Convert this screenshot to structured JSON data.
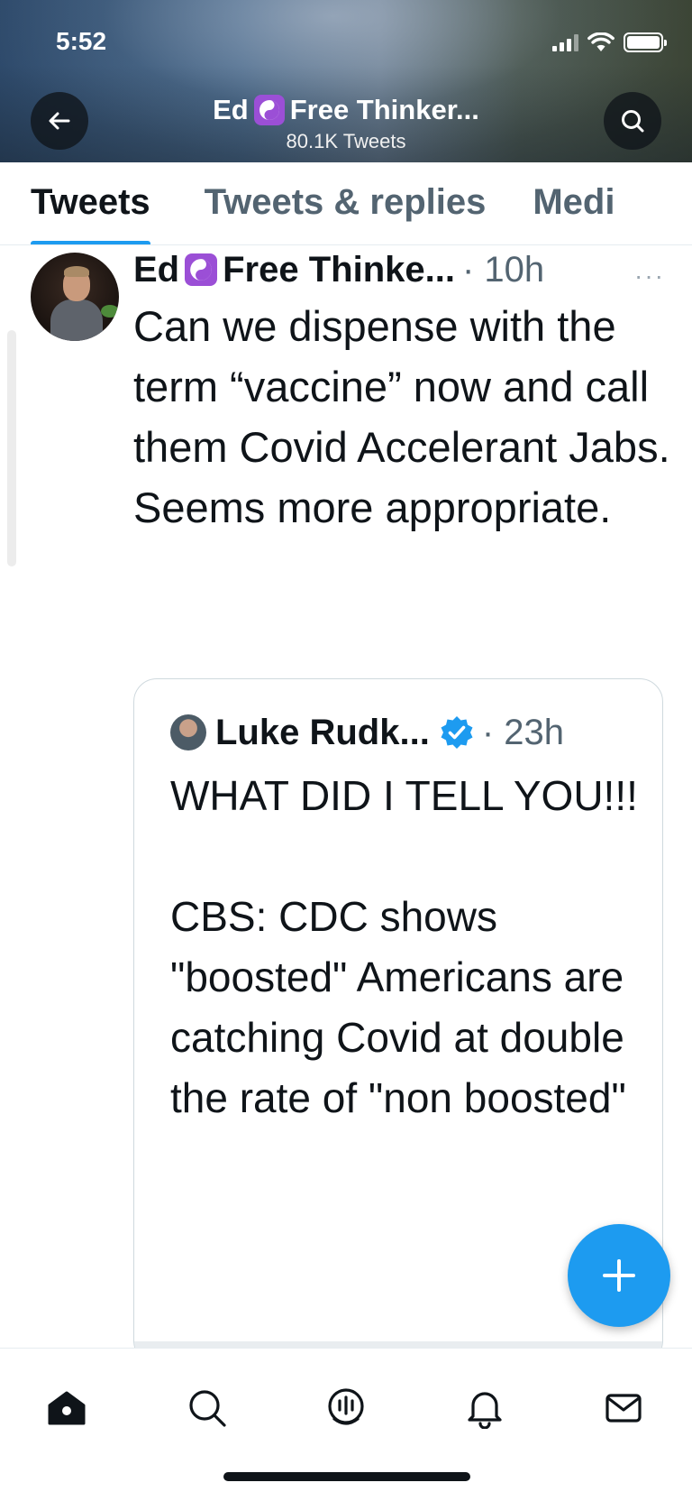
{
  "status_bar": {
    "time": "5:52"
  },
  "header": {
    "name_part1": "Ed",
    "name_part2": "Free Thinker...",
    "tweet_count": "80.1K Tweets"
  },
  "tabs": [
    {
      "label": "Tweets",
      "active": true
    },
    {
      "label": "Tweets & replies",
      "active": false
    },
    {
      "label": "Medi",
      "active": false
    }
  ],
  "tweet": {
    "name_part1": "Ed",
    "name_part2": "Free Thinke...",
    "meta": "· 10h",
    "more": "···",
    "text": "Can we dispense with the term “vaccine” now and call them Covid Accelerant Jabs. Seems more appropriate."
  },
  "quote_tweet": {
    "name": "Luke Rudk...",
    "meta": "· 23h",
    "text": "WHAT DID I TELL YOU!!!\n\nCBS: CDC shows \"boosted\" Americans are catching Covid at double the rate of \"non boosted\""
  },
  "colors": {
    "accent": "#1d9bf0",
    "badge_purple": "#9b4fd6",
    "text_primary": "#0f1419",
    "text_secondary": "#536471"
  },
  "icons": {
    "header": [
      "back-arrow-icon",
      "search-icon",
      "yin-yang-icon"
    ],
    "bottom_nav": [
      "home-icon",
      "search-icon",
      "spaces-icon",
      "notifications-icon",
      "messages-icon"
    ],
    "fab": "plus-icon"
  }
}
